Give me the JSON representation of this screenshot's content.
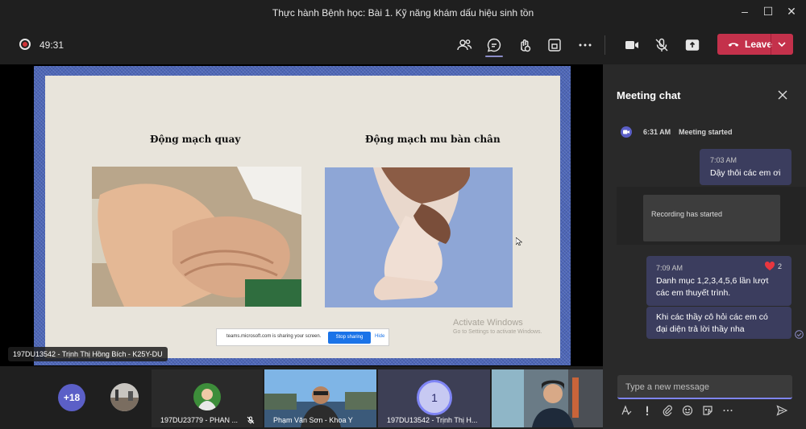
{
  "window": {
    "title": "Thực hành Bệnh học: Bài 1. Kỹ năng khám dấu hiệu sinh tồn"
  },
  "toolbar": {
    "timer": "49:31",
    "leave_label": "Leave"
  },
  "slide": {
    "left_caption": "Động mạch quay",
    "right_caption": "Động mạch mu bàn chân",
    "share_notice": "teams.microsoft.com is sharing your screen.",
    "stop_sharing": "Stop sharing",
    "hide": "Hide",
    "activate_title": "Activate Windows",
    "activate_sub": "Go to Settings to activate Windows."
  },
  "presenter_name": "197DU13542 - Trịnh Thị Hồng Bích - K25Y-DU",
  "gallery": {
    "more_count": "+18",
    "tiles": [
      {
        "name": "197DU23779 - PHAN ..."
      },
      {
        "name": "Phạm Văn Sơn - Khoa Y"
      },
      {
        "name": "197DU13542 - Trịnh Thị H...",
        "avatar_text": "1"
      }
    ]
  },
  "chat": {
    "title": "Meeting chat",
    "system": {
      "time": "6:31 AM",
      "text": "Meeting started"
    },
    "messages": [
      {
        "time": "7:03 AM",
        "text": "Dậy thôi các em ơi"
      },
      {
        "time": "7:09 AM",
        "text_line1": "Danh mục 1,2,3,4,5,6 lần lượt",
        "text_line2": "các em thuyết trình.",
        "reaction_count": "2"
      },
      {
        "text_line1": "Khi các thầy cô hỏi các em có",
        "text_line2": "đại diện trả lời thầy nha"
      }
    ],
    "recording_card": "Recording has started",
    "compose_placeholder": "Type a new message"
  },
  "colors": {
    "leave": "#c4314b",
    "accent": "#7f85f5",
    "bubble": "#3b3d5e",
    "record": "#d13438"
  }
}
